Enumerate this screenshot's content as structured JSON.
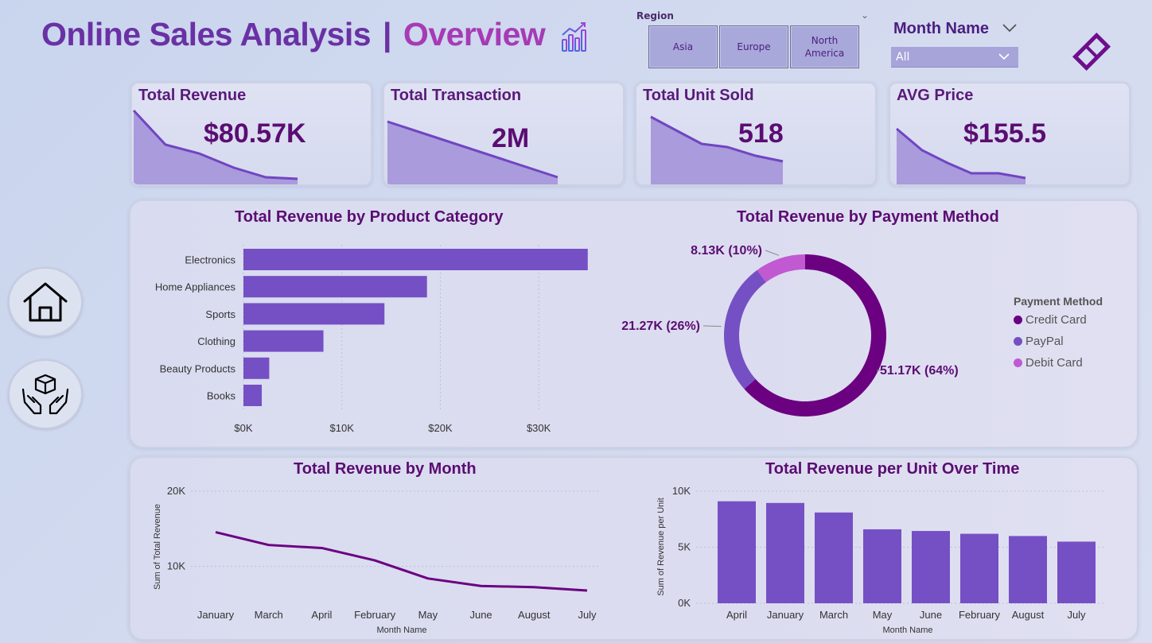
{
  "header": {
    "title_part1": "Online Sales Analysis",
    "separator": "|",
    "title_part2": "Overview",
    "title_icon": "bar-chart-trend-icon"
  },
  "filters": {
    "region": {
      "label": "Region",
      "options": [
        "Asia",
        "Europe",
        "North America"
      ]
    },
    "month": {
      "label": "Month Name",
      "selected": "All"
    }
  },
  "nav": [
    {
      "name": "home",
      "icon": "home-icon"
    },
    {
      "name": "products",
      "icon": "hands-box-icon"
    }
  ],
  "kpis": [
    {
      "label": "Total Revenue",
      "value": "$80.57K"
    },
    {
      "label": "Total Transaction",
      "value": "2M"
    },
    {
      "label": "Total Unit Sold",
      "value": "518"
    },
    {
      "label": "AVG Price",
      "value": "$155.5"
    }
  ],
  "colors": {
    "primary": "#7550c4",
    "dark": "#6b0080",
    "accent": "#c159d1",
    "title": "#5a0d72"
  },
  "chart_data": [
    {
      "type": "bar",
      "orientation": "horizontal",
      "title": "Total Revenue by Product Category",
      "categories": [
        "Electronics",
        "Home Appliances",
        "Sports",
        "Clothing",
        "Beauty Products",
        "Books"
      ],
      "values": [
        34982,
        18646,
        14326,
        8128,
        2621,
        1861
      ],
      "xlim": [
        0,
        35000
      ],
      "xticks": [
        "$0K",
        "$10K",
        "$20K",
        "$30K"
      ],
      "xtick_values": [
        0,
        10000,
        20000,
        30000
      ]
    },
    {
      "type": "pie",
      "style": "donut",
      "title": "Total Revenue by Payment Method",
      "legend_title": "Payment Method",
      "legend_position": "right",
      "slices": [
        {
          "name": "Credit Card",
          "value": 51170,
          "label": "51.17K (64%)",
          "color": "#6b0080"
        },
        {
          "name": "PayPal",
          "value": 21270,
          "label": "21.27K (26%)",
          "color": "#7550c4"
        },
        {
          "name": "Debit Card",
          "value": 8130,
          "label": "8.13K (10%)",
          "color": "#c159d1"
        }
      ]
    },
    {
      "type": "line",
      "title": "Total Revenue by Month",
      "xlabel": "Month Name",
      "ylabel": "Sum of Total Revenue",
      "categories": [
        "January",
        "March",
        "April",
        "February",
        "May",
        "June",
        "August",
        "July"
      ],
      "values": [
        14550,
        12850,
        12450,
        10800,
        8400,
        7400,
        7250,
        6800
      ],
      "ylim": [
        5000,
        20000
      ],
      "yticks": [
        "10K",
        "20K"
      ],
      "ytick_values": [
        10000,
        20000
      ]
    },
    {
      "type": "bar",
      "title": "Total Revenue per Unit Over Time",
      "xlabel": "Month Name",
      "ylabel": "Sum of Revenue per Unit",
      "categories": [
        "April",
        "January",
        "March",
        "May",
        "June",
        "February",
        "August",
        "July"
      ],
      "values": [
        9100,
        8950,
        8100,
        6600,
        6450,
        6200,
        6000,
        5500
      ],
      "ylim": [
        0,
        10000
      ],
      "yticks": [
        "0K",
        "5K",
        "10K"
      ],
      "ytick_values": [
        0,
        5000,
        10000
      ]
    }
  ]
}
